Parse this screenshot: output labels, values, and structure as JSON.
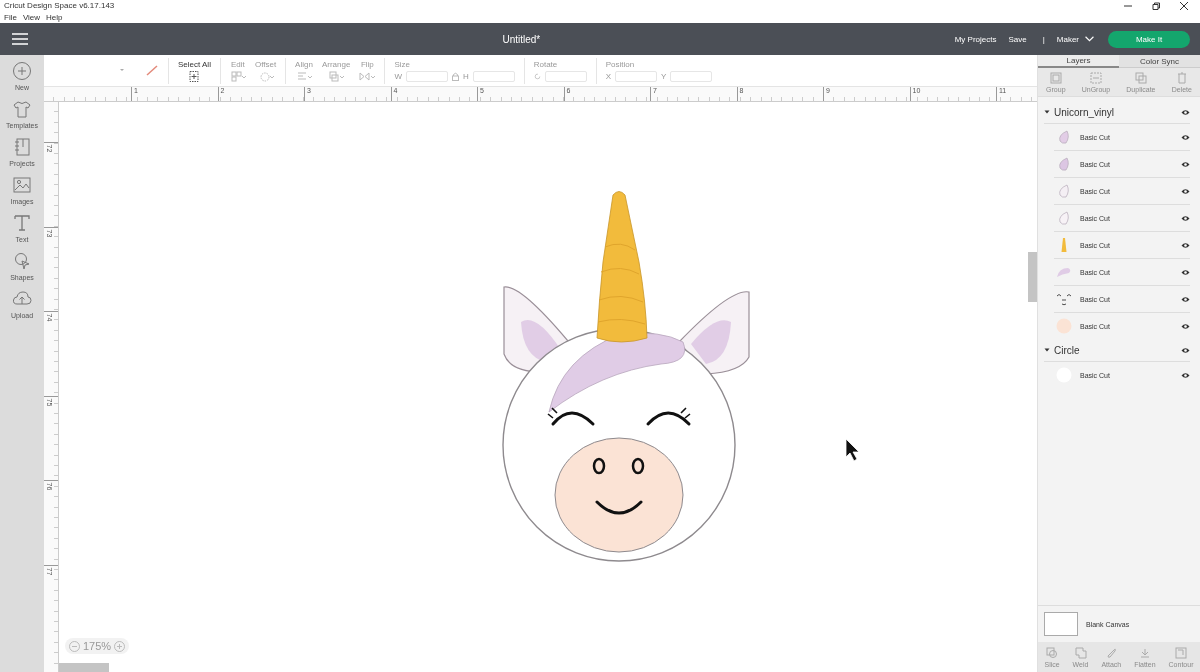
{
  "window": {
    "title": "Cricut Design Space  v6.17.143"
  },
  "menu": [
    "File",
    "View",
    "Help"
  ],
  "header": {
    "title": "Untitled*",
    "links": [
      "My Projects",
      "Save"
    ],
    "separator": "|",
    "machine": "Maker",
    "make_button": "Make It"
  },
  "sidebar": {
    "items": [
      {
        "label": "New"
      },
      {
        "label": "Templates"
      },
      {
        "label": "Projects"
      },
      {
        "label": "Images"
      },
      {
        "label": "Text"
      },
      {
        "label": "Shapes"
      },
      {
        "label": "Upload"
      }
    ]
  },
  "toolbar": [
    {
      "kind": "button",
      "label": "Select All",
      "disabled": false
    },
    {
      "kind": "button",
      "label": "Edit",
      "disabled": true
    },
    {
      "kind": "button",
      "label": "Offset",
      "disabled": true
    },
    {
      "kind": "button",
      "label": "Align",
      "disabled": true
    },
    {
      "kind": "button",
      "label": "Arrange",
      "disabled": true
    },
    {
      "kind": "button",
      "label": "Flip",
      "disabled": true
    },
    {
      "kind": "fields",
      "label": "Size",
      "fields": [
        "W",
        "H"
      ],
      "disabled": true
    },
    {
      "kind": "rotate",
      "label": "Rotate",
      "disabled": true
    },
    {
      "kind": "fields",
      "label": "Position",
      "fields": [
        "X",
        "Y"
      ],
      "disabled": true
    }
  ],
  "ruler": {
    "horizontal": [
      "1",
      "2",
      "3",
      "4",
      "5",
      "6",
      "7",
      "8",
      "9",
      "10",
      "11"
    ],
    "vertical": [
      "72",
      "73",
      "74",
      "75",
      "76",
      "77"
    ]
  },
  "zoom": {
    "value": "175%"
  },
  "layers_panel": {
    "tabs": [
      {
        "label": "Layers",
        "selected": true
      },
      {
        "label": "Color Sync",
        "selected": false
      }
    ],
    "actions": [
      {
        "label": "Group",
        "disabled": true
      },
      {
        "label": "UnGroup",
        "disabled": true
      },
      {
        "label": "Duplicate",
        "disabled": true
      },
      {
        "label": "Delete",
        "disabled": true
      }
    ],
    "layers": [
      {
        "name": "Unicorn_vinyl",
        "expanded": true,
        "visible": true,
        "children": [
          {
            "name": "Basic Cut",
            "kind": "ear",
            "color": "#e2cde6",
            "visible": true
          },
          {
            "name": "Basic Cut",
            "kind": "ear",
            "color": "#dcc6e3",
            "visible": true
          },
          {
            "name": "Basic Cut",
            "kind": "ear",
            "color": "#f4eff4",
            "visible": true
          },
          {
            "name": "Basic Cut",
            "kind": "ear",
            "color": "#f7f2f6",
            "visible": true
          },
          {
            "name": "Basic Cut",
            "kind": "horn",
            "color": "#f2bb3c",
            "visible": true
          },
          {
            "name": "Basic Cut",
            "kind": "mane",
            "color": "#e0cce6",
            "visible": true
          },
          {
            "name": "Basic Cut",
            "kind": "face",
            "visible": true
          },
          {
            "name": "Basic Cut",
            "kind": "circle",
            "color": "#fbe3d5",
            "visible": true
          }
        ]
      },
      {
        "name": "Circle",
        "expanded": true,
        "visible": true,
        "children": [
          {
            "name": "Basic Cut",
            "kind": "circle",
            "color": "#ffffff",
            "visible": true
          }
        ]
      }
    ],
    "canvas_label": "Blank Canvas",
    "bottom_actions": [
      {
        "label": "Slice",
        "disabled": true
      },
      {
        "label": "Weld",
        "disabled": true
      },
      {
        "label": "Attach",
        "disabled": true
      },
      {
        "label": "Flatten",
        "disabled": true
      },
      {
        "label": "Contour",
        "disabled": true
      }
    ]
  }
}
